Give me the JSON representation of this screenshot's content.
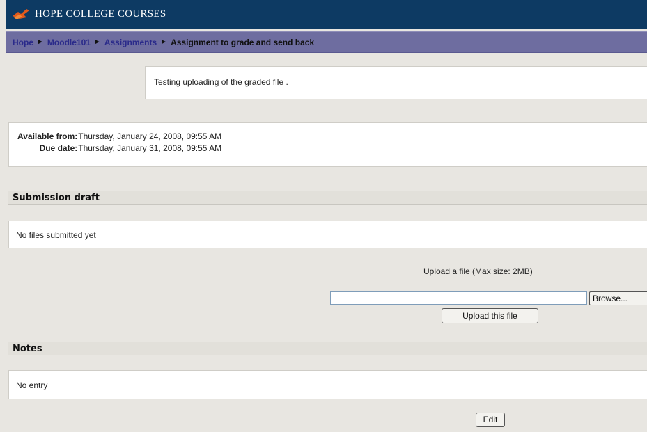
{
  "header": {
    "site_name": "HOPE COLLEGE COURSES",
    "logo_icon": "hope-college-anchor-logo",
    "background": "#0d3a63"
  },
  "breadcrumb": {
    "items": [
      "Hope",
      "Moodle101",
      "Assignments"
    ],
    "current": "Assignment to grade and send back",
    "separator": "►",
    "bar_color": "#6e6da0"
  },
  "intro": {
    "text": "Testing uploading of the graded file ."
  },
  "dates": {
    "available_label": "Available from:",
    "available_value": "Thursday, January 24, 2008, 09:55 AM",
    "due_label": "Due date:",
    "due_value": "Thursday, January 31, 2008, 09:55 AM"
  },
  "submission": {
    "heading": "Submission draft",
    "status": "No files submitted yet",
    "upload_label": "Upload a file (Max size: 2MB)",
    "file_value": "",
    "browse_label": "Browse...",
    "upload_button": "Upload this file"
  },
  "notes": {
    "heading": "Notes",
    "entry": "No entry",
    "edit_button": "Edit"
  }
}
